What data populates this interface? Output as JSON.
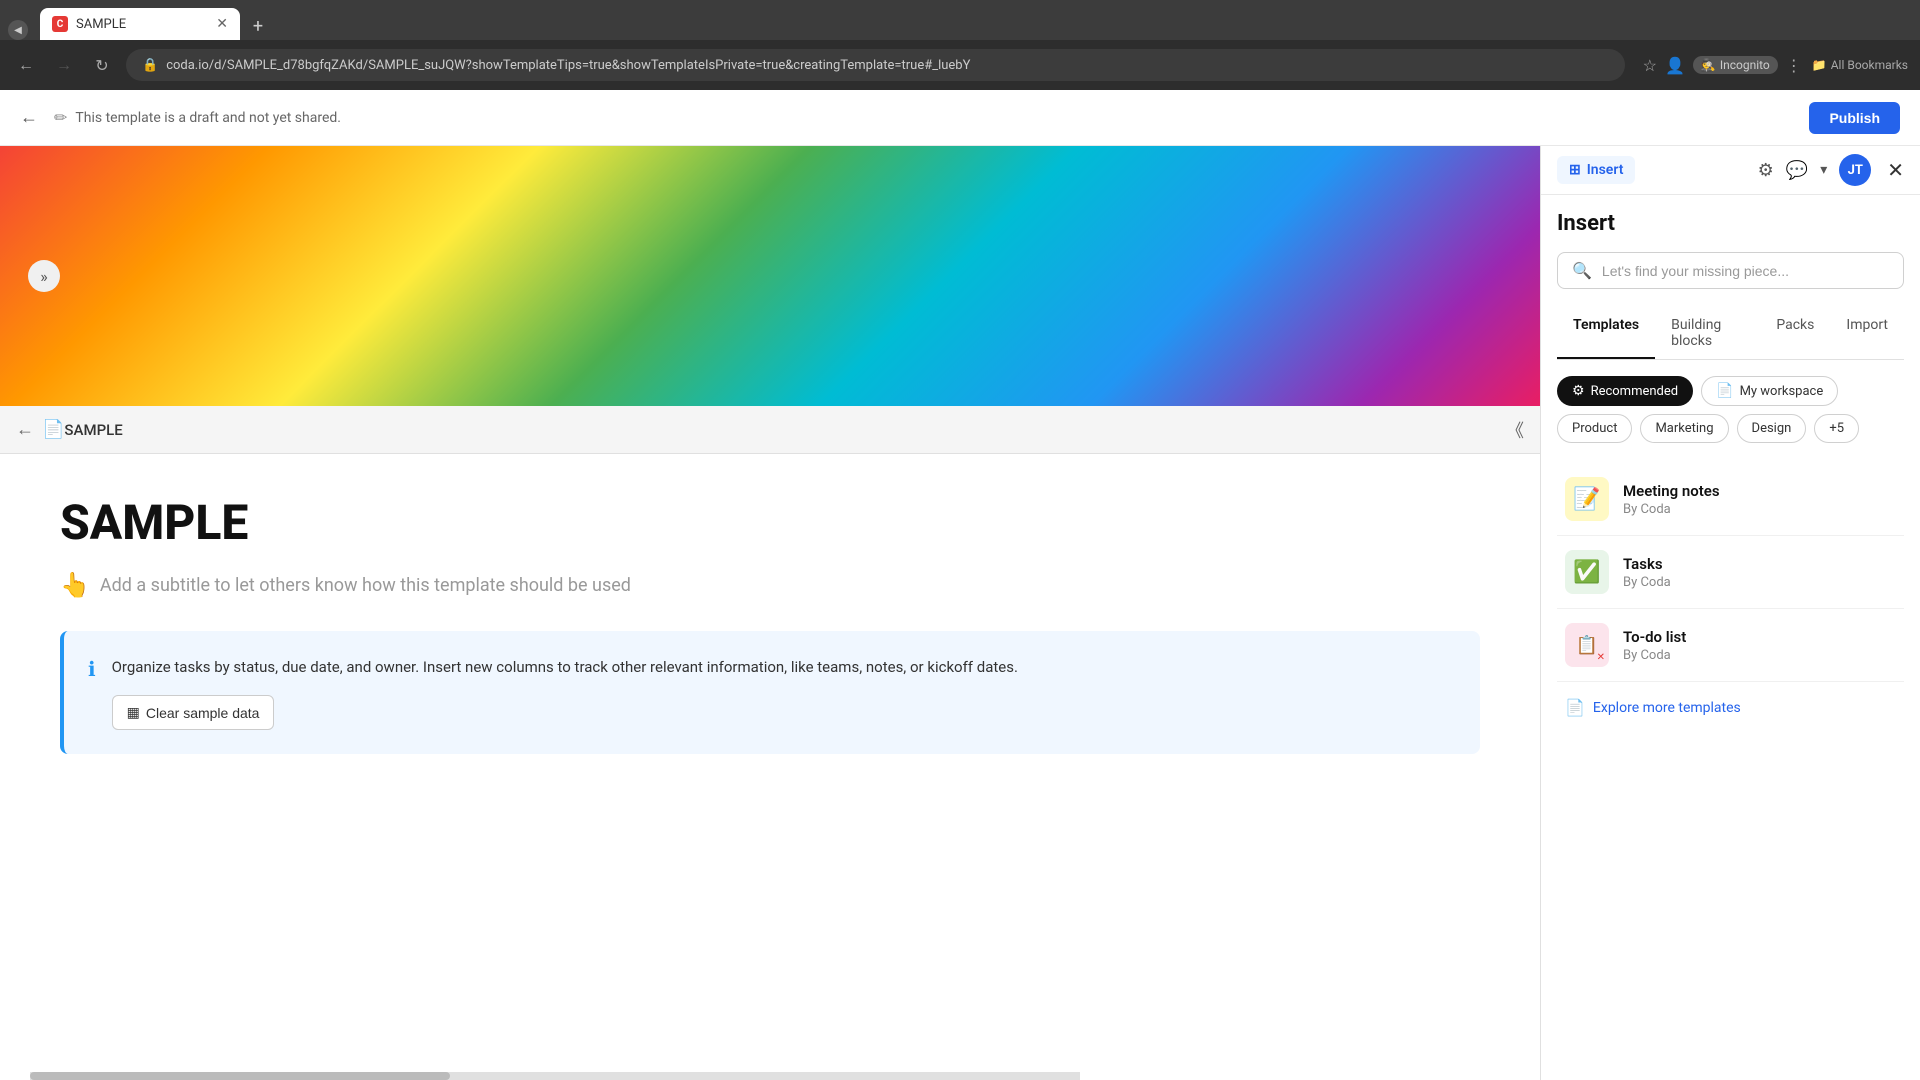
{
  "browser": {
    "tab_title": "SAMPLE",
    "tab_favicon_text": "C",
    "url": "coda.io/d/SAMPLE_d78bgfqZAKd/SAMPLE_suJQW?showTemplateTips=true&showTemplateIsPrivate=true&creatingTemplate=true#_luebY",
    "incognito_label": "Incognito",
    "bookmarks_label": "All Bookmarks"
  },
  "app_header": {
    "draft_notice": "This template is a draft and not yet shared.",
    "publish_label": "Publish"
  },
  "doc": {
    "title": "SAMPLE",
    "file_name": "SAMPLE",
    "subtitle_placeholder": "Add a subtitle to let others know how this template should be used",
    "subtitle_emoji": "👆",
    "info_text": "Organize tasks by status, due date, and owner. Insert new columns to track other relevant information, like teams, notes, or kickoff dates.",
    "clear_btn_label": "Clear sample data"
  },
  "insert_panel": {
    "title": "Insert",
    "insert_btn_label": "Insert",
    "search_placeholder": "Let's find your missing piece...",
    "avatar_initials": "JT",
    "close_label": "×",
    "tabs": [
      {
        "label": "Templates",
        "active": true
      },
      {
        "label": "Building blocks",
        "active": false
      },
      {
        "label": "Packs",
        "active": false
      },
      {
        "label": "Import",
        "active": false
      }
    ],
    "filter_chips": [
      {
        "label": "Recommended",
        "active": true,
        "icon": "⚙"
      },
      {
        "label": "My workspace",
        "active": false,
        "icon": "📄"
      },
      {
        "label": "Product",
        "active": false
      },
      {
        "label": "Marketing",
        "active": false
      },
      {
        "label": "Design",
        "active": false
      },
      {
        "label": "+5",
        "active": false
      }
    ],
    "templates": [
      {
        "name": "Meeting notes",
        "author": "By Coda",
        "icon": "📝",
        "icon_class": "template-icon-yellow"
      },
      {
        "name": "Tasks",
        "author": "By Coda",
        "icon": "✅",
        "icon_class": "template-icon-green"
      },
      {
        "name": "To-do list",
        "author": "By Coda",
        "icon": "📋",
        "icon_class": "template-icon-blue"
      }
    ],
    "explore_label": "Explore more templates"
  }
}
